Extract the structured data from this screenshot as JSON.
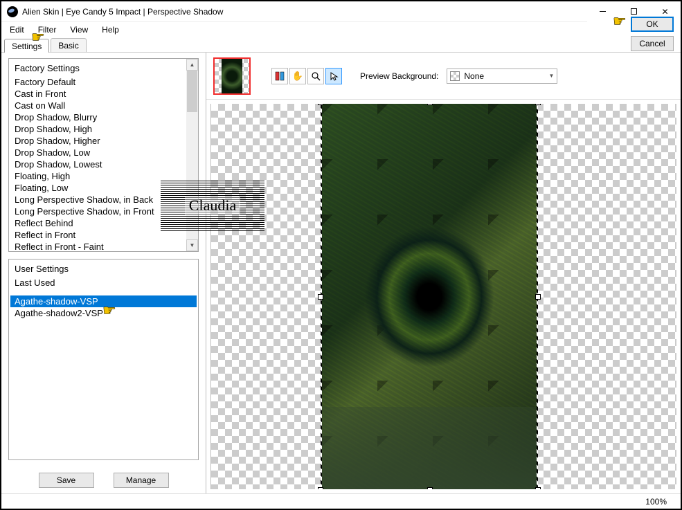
{
  "window": {
    "title": "Alien Skin | Eye Candy 5 Impact | Perspective Shadow"
  },
  "menubar": {
    "items": [
      "Edit",
      "Filter",
      "View",
      "Help"
    ]
  },
  "tabs": {
    "active": "Settings",
    "items": [
      "Settings",
      "Basic"
    ]
  },
  "factory": {
    "header": "Factory Settings",
    "items": [
      "Factory Default",
      "Cast in Front",
      "Cast on Wall",
      "Drop Shadow, Blurry",
      "Drop Shadow, High",
      "Drop Shadow, Higher",
      "Drop Shadow, Low",
      "Drop Shadow, Lowest",
      "Floating, High",
      "Floating, Low",
      "Long Perspective Shadow, in Back",
      "Long Perspective Shadow, in Front",
      "Reflect Behind",
      "Reflect in Front",
      "Reflect in Front - Faint"
    ]
  },
  "user": {
    "header": "User Settings",
    "lastUsed": "Last Used",
    "items": [
      "Agathe-shadow-VSP",
      "Agathe-shadow2-VSP"
    ],
    "selectedIndex": 0
  },
  "buttons": {
    "save": "Save",
    "manage": "Manage",
    "ok": "OK",
    "cancel": "Cancel"
  },
  "preview": {
    "label": "Preview Background:",
    "value": "None"
  },
  "watermark": "Claudia",
  "status": {
    "zoom": "100%"
  }
}
